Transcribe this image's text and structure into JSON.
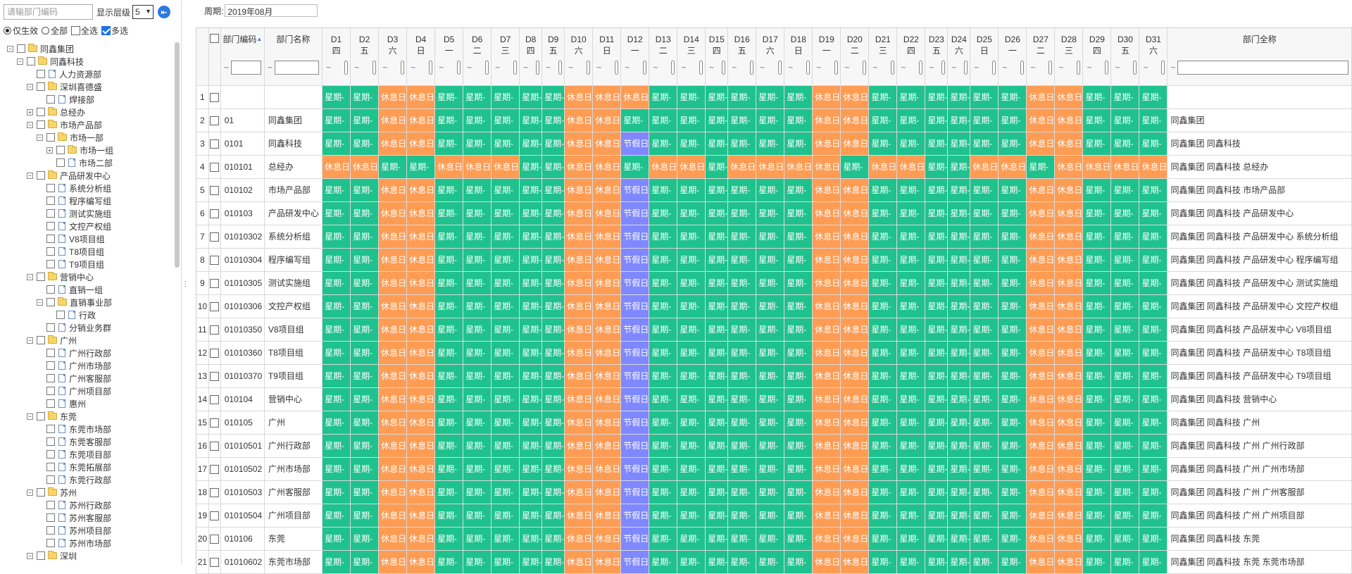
{
  "left": {
    "search_placeholder": "请输部门编码",
    "level_label": "显示层级",
    "level_value": "5",
    "filters": [
      {
        "label": "仅生效",
        "type": "radio",
        "on": true
      },
      {
        "label": "全部",
        "type": "radio",
        "on": false
      },
      {
        "label": "全选",
        "type": "check",
        "on": false
      },
      {
        "label": "多选",
        "type": "check",
        "on": true
      }
    ],
    "tree": [
      {
        "label": "同鑫集团",
        "level": 0,
        "folder": true,
        "toggle": "-"
      },
      {
        "label": "同鑫科技",
        "level": 1,
        "folder": true,
        "toggle": "-"
      },
      {
        "label": "人力资源部",
        "level": 2,
        "folder": false,
        "toggle": ""
      },
      {
        "label": "深圳喜德盛",
        "level": 2,
        "folder": true,
        "toggle": "-"
      },
      {
        "label": "焊接部",
        "level": 3,
        "folder": false,
        "toggle": ""
      },
      {
        "label": "总经办",
        "level": 2,
        "folder": true,
        "toggle": "+"
      },
      {
        "label": "市场产品部",
        "level": 2,
        "folder": true,
        "toggle": "-"
      },
      {
        "label": "市场一部",
        "level": 3,
        "folder": true,
        "toggle": "-"
      },
      {
        "label": "市场一组",
        "level": 4,
        "folder": true,
        "toggle": "+"
      },
      {
        "label": "市场二部",
        "level": 4,
        "folder": false,
        "toggle": ""
      },
      {
        "label": "产品研发中心",
        "level": 2,
        "folder": true,
        "toggle": "-"
      },
      {
        "label": "系统分析组",
        "level": 3,
        "folder": false,
        "toggle": ""
      },
      {
        "label": "程序编写组",
        "level": 3,
        "folder": false,
        "toggle": ""
      },
      {
        "label": "测试实施组",
        "level": 3,
        "folder": false,
        "toggle": ""
      },
      {
        "label": "文控产权组",
        "level": 3,
        "folder": false,
        "toggle": ""
      },
      {
        "label": "V8项目组",
        "level": 3,
        "folder": false,
        "toggle": ""
      },
      {
        "label": "T8项目组",
        "level": 3,
        "folder": false,
        "toggle": ""
      },
      {
        "label": "T9项目组",
        "level": 3,
        "folder": false,
        "toggle": ""
      },
      {
        "label": "营销中心",
        "level": 2,
        "folder": true,
        "toggle": "-"
      },
      {
        "label": "直销一组",
        "level": 3,
        "folder": false,
        "toggle": ""
      },
      {
        "label": "直销事业部",
        "level": 3,
        "folder": true,
        "toggle": "-"
      },
      {
        "label": "行政",
        "level": 4,
        "folder": false,
        "toggle": ""
      },
      {
        "label": "分销业务群",
        "level": 3,
        "folder": false,
        "toggle": ""
      },
      {
        "label": "广州",
        "level": 2,
        "folder": true,
        "toggle": "-"
      },
      {
        "label": "广州行政部",
        "level": 3,
        "folder": false,
        "toggle": ""
      },
      {
        "label": "广州市场部",
        "level": 3,
        "folder": false,
        "toggle": ""
      },
      {
        "label": "广州客服部",
        "level": 3,
        "folder": false,
        "toggle": ""
      },
      {
        "label": "广州项目部",
        "level": 3,
        "folder": false,
        "toggle": ""
      },
      {
        "label": "惠州",
        "level": 3,
        "folder": false,
        "toggle": ""
      },
      {
        "label": "东莞",
        "level": 2,
        "folder": true,
        "toggle": "-"
      },
      {
        "label": "东莞市场部",
        "level": 3,
        "folder": false,
        "toggle": ""
      },
      {
        "label": "东莞客服部",
        "level": 3,
        "folder": false,
        "toggle": ""
      },
      {
        "label": "东莞项目部",
        "level": 3,
        "folder": false,
        "toggle": ""
      },
      {
        "label": "东莞拓展部",
        "level": 3,
        "folder": false,
        "toggle": ""
      },
      {
        "label": "东莞行政部",
        "level": 3,
        "folder": false,
        "toggle": ""
      },
      {
        "label": "苏州",
        "level": 2,
        "folder": true,
        "toggle": "-"
      },
      {
        "label": "苏州行政部",
        "level": 3,
        "folder": false,
        "toggle": ""
      },
      {
        "label": "苏州客服部",
        "level": 3,
        "folder": false,
        "toggle": ""
      },
      {
        "label": "苏州项目部",
        "level": 3,
        "folder": false,
        "toggle": ""
      },
      {
        "label": "苏州市场部",
        "level": 3,
        "folder": false,
        "toggle": ""
      },
      {
        "label": "深圳",
        "level": 2,
        "folder": true,
        "toggle": "-"
      }
    ]
  },
  "right": {
    "period_label": "周期:",
    "period_value": "2019年08月",
    "headers": {
      "code": "部门编码",
      "name": "部门名称",
      "full": "部门全称",
      "filter_mark": "~",
      "days": [
        {
          "d": "D1",
          "w": "四"
        },
        {
          "d": "D2",
          "w": "五"
        },
        {
          "d": "D3",
          "w": "六"
        },
        {
          "d": "D4",
          "w": "日"
        },
        {
          "d": "D5",
          "w": "一"
        },
        {
          "d": "D6",
          "w": "二"
        },
        {
          "d": "D7",
          "w": "三"
        },
        {
          "d": "D8",
          "w": "四"
        },
        {
          "d": "D9",
          "w": "五"
        },
        {
          "d": "D10",
          "w": "六"
        },
        {
          "d": "D11",
          "w": "日"
        },
        {
          "d": "D12",
          "w": "一"
        },
        {
          "d": "D13",
          "w": "二"
        },
        {
          "d": "D14",
          "w": "三"
        },
        {
          "d": "D15",
          "w": "四"
        },
        {
          "d": "D16",
          "w": "五"
        },
        {
          "d": "D17",
          "w": "六"
        },
        {
          "d": "D18",
          "w": "日"
        },
        {
          "d": "D19",
          "w": "一"
        },
        {
          "d": "D20",
          "w": "二"
        },
        {
          "d": "D21",
          "w": "三"
        },
        {
          "d": "D22",
          "w": "四"
        },
        {
          "d": "D23",
          "w": "五"
        },
        {
          "d": "D24",
          "w": "六"
        },
        {
          "d": "D25",
          "w": "日"
        },
        {
          "d": "D26",
          "w": "一"
        },
        {
          "d": "D27",
          "w": "二"
        },
        {
          "d": "D28",
          "w": "三"
        },
        {
          "d": "D29",
          "w": "四"
        },
        {
          "d": "D30",
          "w": "五"
        },
        {
          "d": "D31",
          "w": "六"
        }
      ]
    },
    "cell_text": {
      "g": "星期-",
      "o": "休息日",
      "p": "节假日"
    },
    "colors": {
      "workday": "#1fc28c",
      "rest": "#ff9c54",
      "holiday": "#7f88ff"
    },
    "pattern_standard": "ggoogggggoopggggggooggggggooggggo",
    "pattern_row1": "ggoogggggoooggggggooggggggooggggo",
    "pattern_row2": "ggoogggggoogggggggooggggggooggggo",
    "pattern_row4": "ooggoooggoogoogoooogooggoogooooo",
    "rows": [
      {
        "n": "1",
        "code": "",
        "name": "",
        "full": "",
        "pattern": "row1"
      },
      {
        "n": "2",
        "code": "01",
        "name": "同鑫集团",
        "full": "同鑫集团",
        "pattern": "row2"
      },
      {
        "n": "3",
        "code": "0101",
        "name": "同鑫科技",
        "full": "同鑫集团 同鑫科技",
        "pattern": "standard"
      },
      {
        "n": "4",
        "code": "010101",
        "name": "总经办",
        "full": "同鑫集团 同鑫科技 总经办",
        "pattern": "row4"
      },
      {
        "n": "5",
        "code": "010102",
        "name": "市场产品部",
        "full": "同鑫集团 同鑫科技 市场产品部",
        "pattern": "standard"
      },
      {
        "n": "6",
        "code": "010103",
        "name": "产品研发中心",
        "full": "同鑫集团 同鑫科技 产品研发中心",
        "pattern": "standard"
      },
      {
        "n": "7",
        "code": "01010302",
        "name": "系统分析组",
        "full": "同鑫集团 同鑫科技 产品研发中心 系统分析组",
        "pattern": "standard"
      },
      {
        "n": "8",
        "code": "01010304",
        "name": "程序编写组",
        "full": "同鑫集团 同鑫科技 产品研发中心 程序编写组",
        "pattern": "standard"
      },
      {
        "n": "9",
        "code": "01010305",
        "name": "测试实施组",
        "full": "同鑫集团 同鑫科技 产品研发中心 测试实施组",
        "pattern": "standard"
      },
      {
        "n": "10",
        "code": "01010306",
        "name": "文控产权组",
        "full": "同鑫集团 同鑫科技 产品研发中心 文控产权组",
        "pattern": "standard"
      },
      {
        "n": "11",
        "code": "01010350",
        "name": "V8项目组",
        "full": "同鑫集团 同鑫科技 产品研发中心 V8项目组",
        "pattern": "standard"
      },
      {
        "n": "12",
        "code": "01010360",
        "name": "T8项目组",
        "full": "同鑫集团 同鑫科技 产品研发中心 T8项目组",
        "pattern": "standard"
      },
      {
        "n": "13",
        "code": "01010370",
        "name": "T9项目组",
        "full": "同鑫集团 同鑫科技 产品研发中心 T9项目组",
        "pattern": "standard"
      },
      {
        "n": "14",
        "code": "010104",
        "name": "营销中心",
        "full": "同鑫集团 同鑫科技 营销中心",
        "pattern": "standard"
      },
      {
        "n": "15",
        "code": "010105",
        "name": "广州",
        "full": "同鑫集团 同鑫科技 广州",
        "pattern": "standard"
      },
      {
        "n": "16",
        "code": "01010501",
        "name": "广州行政部",
        "full": "同鑫集团 同鑫科技 广州 广州行政部",
        "pattern": "standard"
      },
      {
        "n": "17",
        "code": "01010502",
        "name": "广州市场部",
        "full": "同鑫集团 同鑫科技 广州 广州市场部",
        "pattern": "standard"
      },
      {
        "n": "18",
        "code": "01010503",
        "name": "广州客服部",
        "full": "同鑫集团 同鑫科技 广州 广州客服部",
        "pattern": "standard"
      },
      {
        "n": "19",
        "code": "01010504",
        "name": "广州项目部",
        "full": "同鑫集团 同鑫科技 广州 广州项目部",
        "pattern": "standard"
      },
      {
        "n": "20",
        "code": "010106",
        "name": "东莞",
        "full": "同鑫集团 同鑫科技 东莞",
        "pattern": "standard"
      },
      {
        "n": "21",
        "code": "01010602",
        "name": "东莞市场部",
        "full": "同鑫集团 同鑫科技 东莞 东莞市场部",
        "pattern": "standard"
      }
    ]
  }
}
